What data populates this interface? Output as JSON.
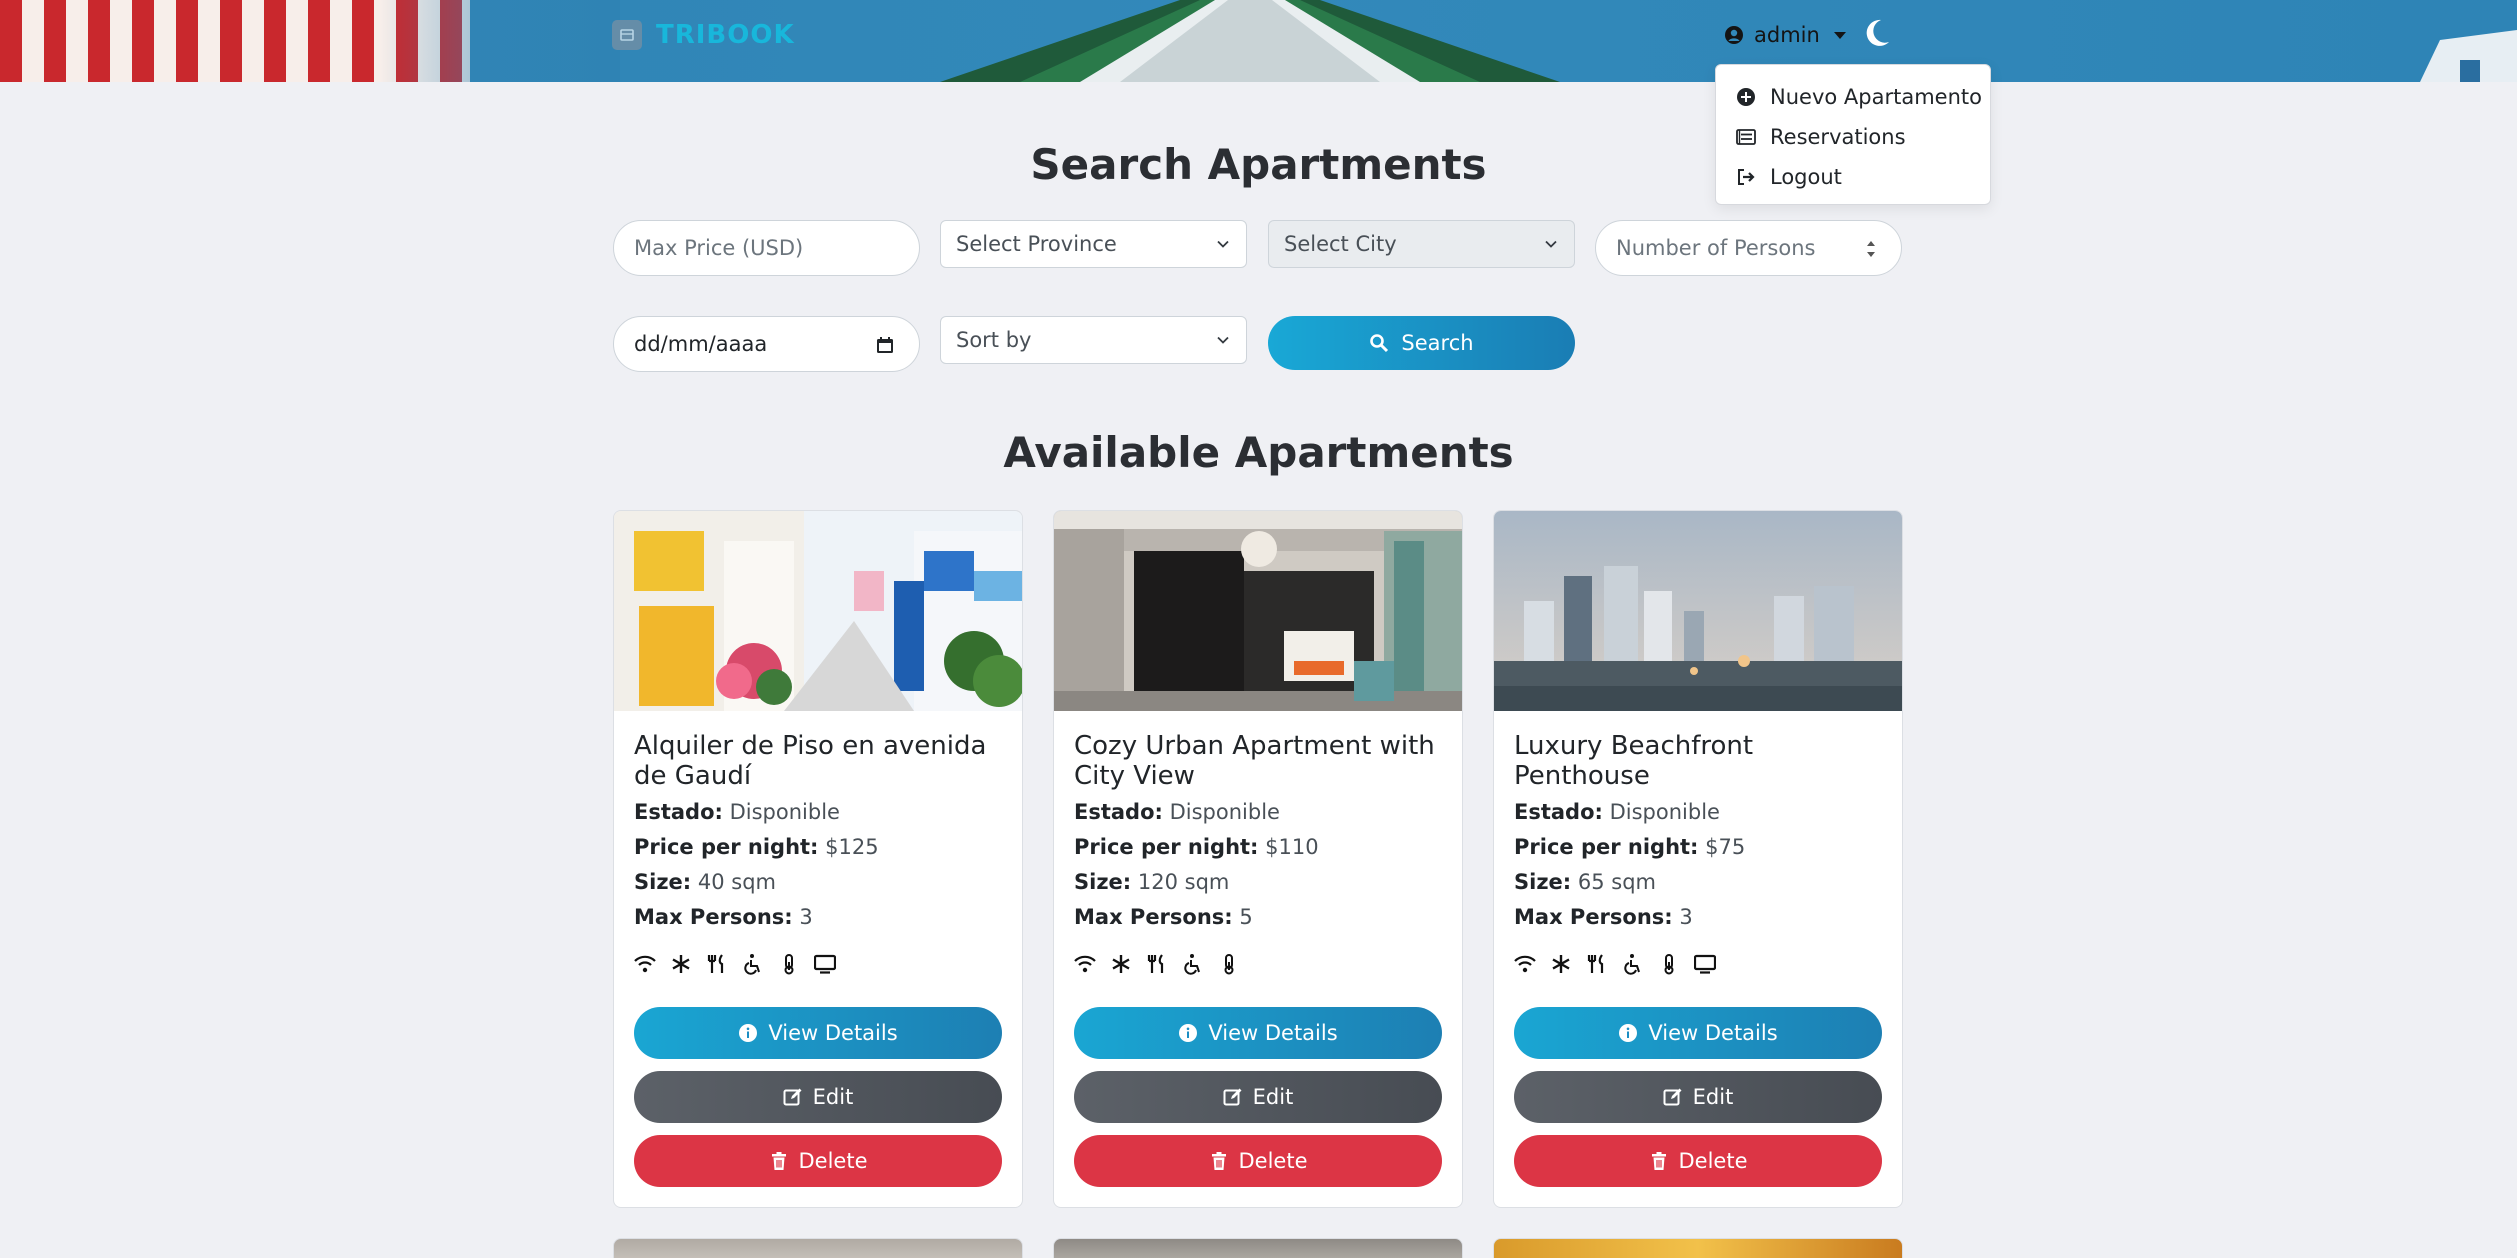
{
  "navbar": {
    "brand": "TRIBOOK",
    "user": "admin"
  },
  "user_dropdown": {
    "items": [
      {
        "label": "Nuevo Apartamento",
        "icon": "plus-circle-icon"
      },
      {
        "label": "Reservations",
        "icon": "list-icon"
      },
      {
        "label": "Logout",
        "icon": "sign-out-icon"
      }
    ]
  },
  "search": {
    "title": "Search Apartments",
    "max_price_placeholder": "Max Price (USD)",
    "province_select": "Select Province",
    "city_select": "Select City",
    "persons_placeholder": "Number of Persons",
    "date_value": "dd/mm/aaaa",
    "sort_select": "Sort by",
    "search_button": "Search"
  },
  "available": {
    "title": "Available Apartments",
    "labels": {
      "estado": "Estado:",
      "price": "Price per night:",
      "size": "Size:",
      "max_persons": "Max Persons:"
    },
    "buttons": {
      "view": "View Details",
      "edit": "Edit",
      "delete": "Delete"
    },
    "cards": [
      {
        "title": "Alquiler de Piso en avenida de Gaudí",
        "estado": "Disponible",
        "price": "$125",
        "size": "40 sqm",
        "max_persons": "3",
        "amenities": [
          "wifi-icon",
          "snowflake-icon",
          "utensils-icon",
          "wheelchair-icon",
          "thermometer-icon",
          "tv-icon"
        ]
      },
      {
        "title": "Cozy Urban Apartment with City View",
        "estado": "Disponible",
        "price": "$110",
        "size": "120 sqm",
        "max_persons": "5",
        "amenities": [
          "wifi-icon",
          "snowflake-icon",
          "utensils-icon",
          "wheelchair-icon",
          "thermometer-icon"
        ]
      },
      {
        "title": "Luxury Beachfront Penthouse",
        "estado": "Disponible",
        "price": "$75",
        "size": "65 sqm",
        "max_persons": "3",
        "amenities": [
          "wifi-icon",
          "snowflake-icon",
          "utensils-icon",
          "wheelchair-icon",
          "thermometer-icon",
          "tv-icon"
        ]
      }
    ]
  },
  "colors": {
    "accent": "#1a8fc4",
    "brand": "#18b7db",
    "danger": "#dc3545",
    "secondary": "#525860",
    "page_bg": "#eff0f4"
  }
}
